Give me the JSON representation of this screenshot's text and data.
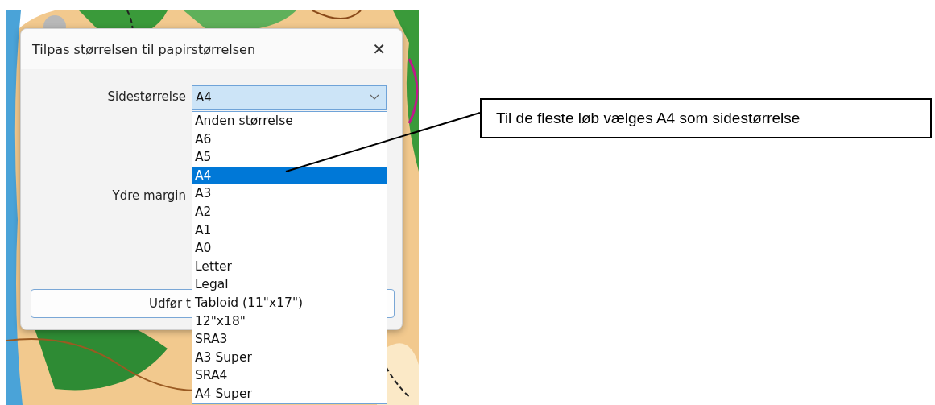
{
  "dialog": {
    "title": "Tilpas størrelsen til papirstørrelsen",
    "close": "✕",
    "page_size": {
      "label": "Sidestørrelse",
      "value": "A4",
      "expanded": true,
      "options": [
        {
          "label": "Anden størrelse",
          "selected": false
        },
        {
          "label": "A6",
          "selected": false
        },
        {
          "label": "A5",
          "selected": false
        },
        {
          "label": "A4",
          "selected": true
        },
        {
          "label": "A3",
          "selected": false
        },
        {
          "label": "A2",
          "selected": false
        },
        {
          "label": "A1",
          "selected": false
        },
        {
          "label": "A0",
          "selected": false
        },
        {
          "label": "Letter",
          "selected": false
        },
        {
          "label": "Legal",
          "selected": false
        },
        {
          "label": "Tabloid (11\"x17\")",
          "selected": false
        },
        {
          "label": "12\"x18\"",
          "selected": false
        },
        {
          "label": "SRA3",
          "selected": false
        },
        {
          "label": "A3 Super",
          "selected": false
        },
        {
          "label": "SRA4",
          "selected": false
        },
        {
          "label": "A4 Super",
          "selected": false
        }
      ]
    },
    "outer_margin": {
      "label": "Ydre margin"
    },
    "apply_button": "Udfør t"
  },
  "callout": {
    "text": "Til de fleste løb vælges A4 som sidestørrelse"
  }
}
